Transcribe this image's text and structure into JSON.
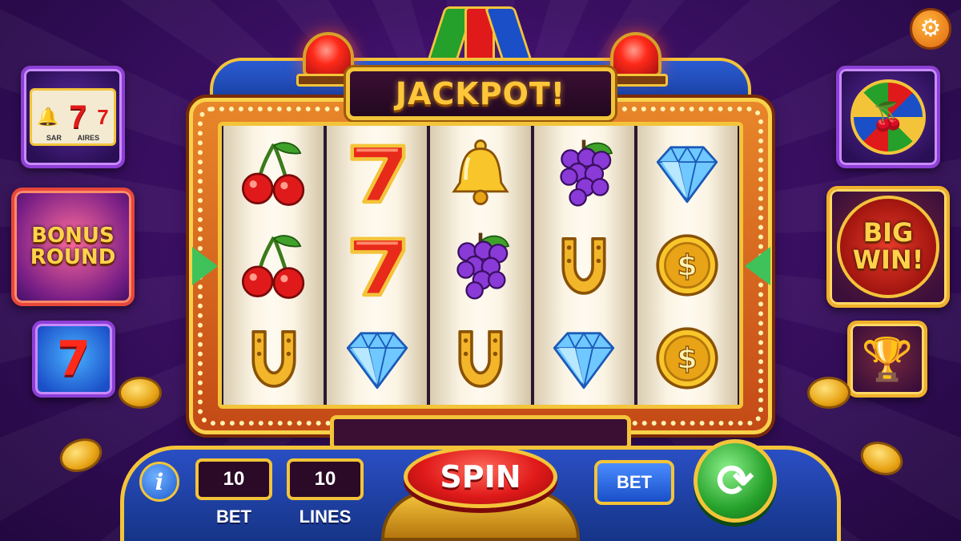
{
  "game": {
    "sign": "JACKPOT!",
    "spin_label": "SPIN",
    "bet_button_label": "BET",
    "info_label": "i"
  },
  "readouts": {
    "bet": {
      "value": "10",
      "label": "BET"
    },
    "lines": {
      "value": "10",
      "label": "LINES"
    }
  },
  "side_tiles": {
    "left": [
      {
        "name": "mini-slot",
        "mini_labels": [
          "SAR",
          "AIRES"
        ]
      },
      {
        "name": "bonus-round",
        "line1": "BONUS",
        "line2": "ROUND"
      },
      {
        "name": "seven",
        "text": "7"
      }
    ],
    "right": [
      {
        "name": "cherry-wheel"
      },
      {
        "name": "big-win",
        "line1": "BIG",
        "line2": "WIN!"
      },
      {
        "name": "trophy"
      }
    ]
  },
  "reels": [
    [
      "cherry",
      "cherry",
      "horseshoe"
    ],
    [
      "seven",
      "seven",
      "diamond"
    ],
    [
      "bell",
      "grapes",
      "horseshoe"
    ],
    [
      "grapes",
      "horseshoe",
      "diamond"
    ],
    [
      "diamond",
      "coin",
      "coin"
    ]
  ],
  "icons": {
    "settings": "gear-icon",
    "autospin": "refresh-icon",
    "info": "info-icon"
  },
  "colors": {
    "background": "#3a0f63",
    "gold_trim": "#f3c43a",
    "spin_red": "#e01a1a",
    "autospin_green": "#25a02a",
    "console_blue": "#2a4fc4"
  }
}
